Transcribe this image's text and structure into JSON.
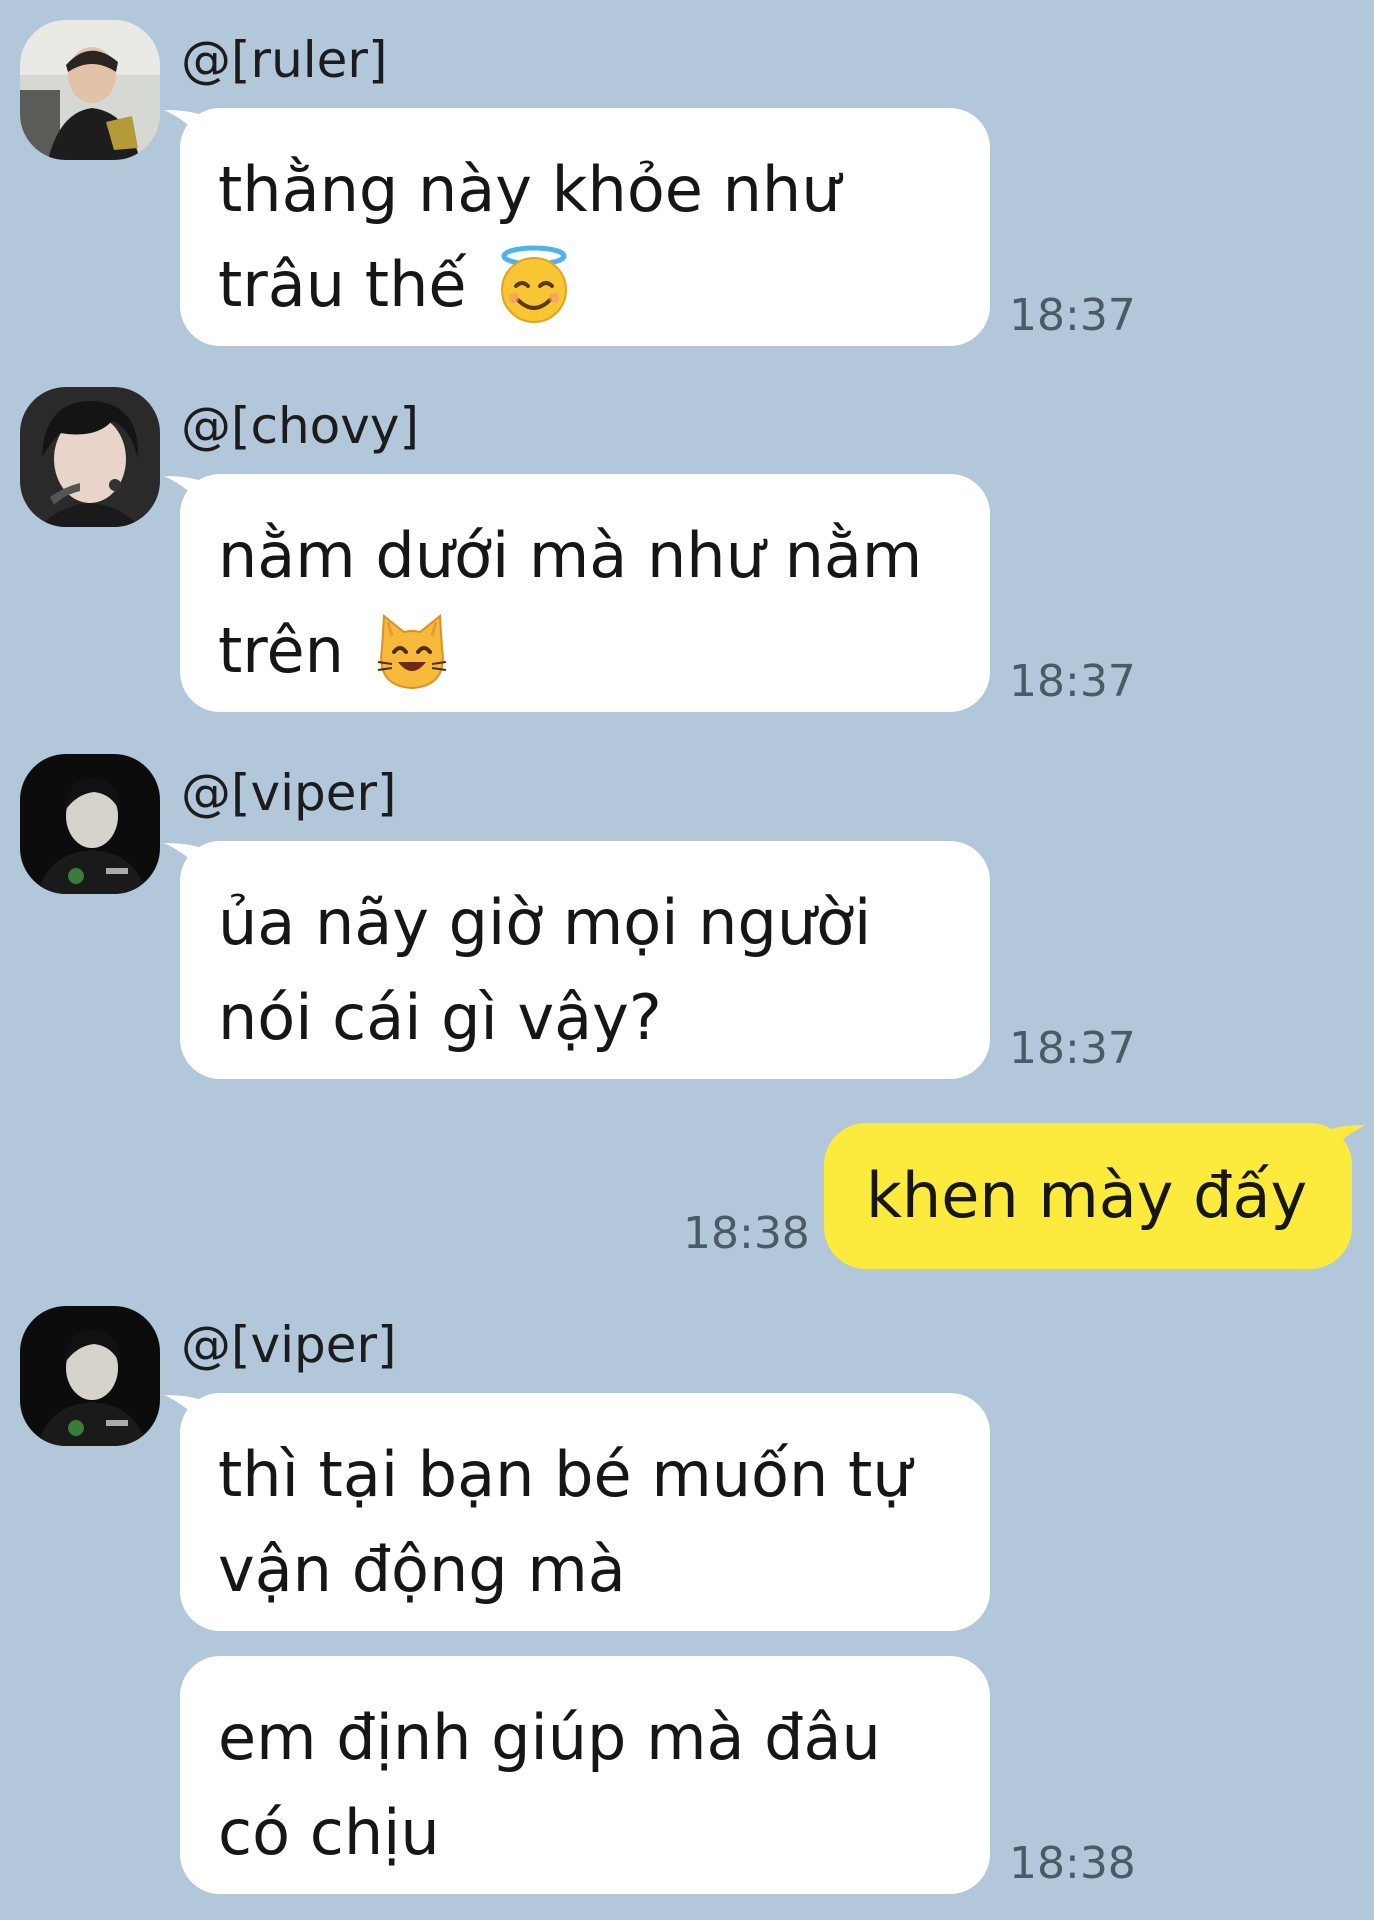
{
  "messages": [
    {
      "sender": "@[ruler]",
      "lines": [
        "thằng này khỏe như",
        "trâu thế"
      ],
      "emoji": "smiling-face-with-halo",
      "time": "18:37"
    },
    {
      "sender": "@[chovy]",
      "lines": [
        "nằm dưới mà như nằm",
        "trên"
      ],
      "emoji": "grinning-cat",
      "time": "18:37"
    },
    {
      "sender": "@[viper]",
      "lines": [
        "ủa nãy giờ mọi người",
        "nói cái gì vậy?"
      ],
      "time": "18:37"
    }
  ],
  "outgoing": {
    "text": "khen mày đấy",
    "time": "18:38"
  },
  "last_group": {
    "sender": "@[viper]",
    "bubble1": [
      "thì tại bạn bé muốn tự",
      "vận động mà"
    ],
    "bubble2": [
      "em định giúp mà đâu",
      "có chịu"
    ],
    "time": "18:38"
  },
  "colors": {
    "background": "#b2c7da",
    "incoming_bubble": "#ffffff",
    "outgoing_bubble": "#fceb3c"
  }
}
